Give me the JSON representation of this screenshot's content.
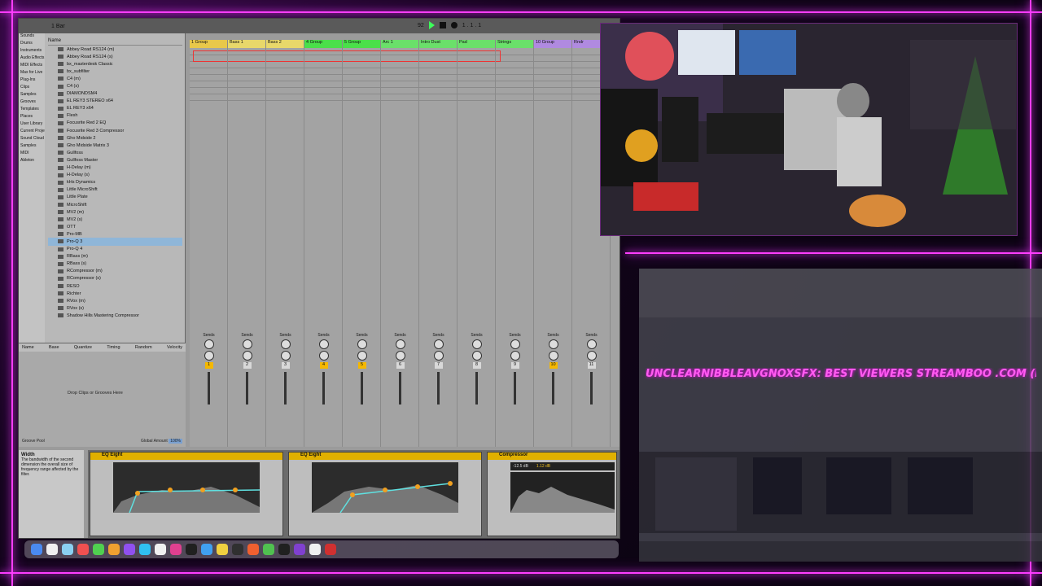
{
  "overlay": {
    "ticker_text": "UNCLEARNIBBLEAVGNOXSFX:  BEST VIEWERS STREAMBOO .COM (REMOVE THE SPA"
  },
  "daw": {
    "topbar": {
      "bpm": "92",
      "bars": "1 Bar",
      "counter": "1 . 1 . 1"
    },
    "browser": {
      "header": "Name",
      "categories": [
        "Sounds",
        "Drums",
        "Instruments",
        "Audio Effects",
        "MIDI Effects",
        "Max for Live",
        "Plug-Ins",
        "Clips",
        "Samples",
        "Grooves",
        "Templates",
        "Places",
        "User Library",
        "Current Project",
        "Sound Cloud",
        "Samples",
        "MIDI",
        "Ableton"
      ],
      "plugins": [
        "Abbey Road RS124 (m)",
        "Abbey Road RS124 (s)",
        "bx_masterdesk Classic",
        "bx_subfilter",
        "C4 (m)",
        "C4 (s)",
        "DIAMONDSM4",
        "EL REY3 STEREO x64",
        "EL REY3 x64",
        "Flesh",
        "Focusrite Red 2 EQ",
        "Focusrite Red 3 Compressor",
        "Gho Midside 2",
        "Gho Midside Matrix 3",
        "Gullfoss",
        "Gullfoss Master",
        "H-Delay (m)",
        "H-Delay (s)",
        "kHs Dynamics",
        "Little MicroShift",
        "Little Plate",
        "MicroShift",
        "MV2 (m)",
        "MV2 (s)",
        "OTT",
        "Pro-MB",
        "Pro-Q 3",
        "Pro-Q 4",
        "RBass (m)",
        "RBass (s)",
        "RCompressor (m)",
        "RCompressor (s)",
        "RESO",
        "Richter",
        "RVox (m)",
        "RVox (s)",
        "Shadow Hills Mastering Compressor"
      ],
      "selected_index": 26
    },
    "groove_pool": {
      "columns": [
        "Name",
        "Base",
        "Quantize",
        "Timing",
        "Random",
        "Velocity"
      ],
      "drop_text": "Drop Clips or Grooves Here",
      "global_amount_label": "Global Amount",
      "global_amount_value": "100%",
      "footer_left": "Groove Pool"
    },
    "info_view": {
      "title": "Width",
      "text": "The bandwidth of the second dimension the overall size of frequency range affected by the filter."
    },
    "tracks": [
      {
        "name": "1 Group",
        "color": "#e8c84a",
        "num": "1",
        "on": true
      },
      {
        "name": "Bass 1",
        "color": "#e8d86a",
        "num": "2",
        "on": false
      },
      {
        "name": "Bass 2",
        "color": "#e8d86a",
        "num": "3",
        "on": false
      },
      {
        "name": "4 Group",
        "color": "#4ae04a",
        "num": "4",
        "on": true
      },
      {
        "name": "5 Group",
        "color": "#4ae04a",
        "num": "5",
        "on": true
      },
      {
        "name": "Arc 1",
        "color": "#6ae06a",
        "num": "6",
        "on": false
      },
      {
        "name": "Intro Dust",
        "color": "#6ae06a",
        "num": "7",
        "on": false
      },
      {
        "name": "Pad",
        "color": "#6ae06a",
        "num": "8",
        "on": false
      },
      {
        "name": "Strings",
        "color": "#6ae06a",
        "num": "9",
        "on": false
      },
      {
        "name": "10 Group",
        "color": "#b08ae0",
        "num": "10",
        "on": true
      },
      {
        "name": "Rndr",
        "color": "#b08ae0",
        "num": "11",
        "on": false
      }
    ],
    "mixer_labels": {
      "audio_from": "Audio From",
      "monitor": "Monitor",
      "audio_to": "Audio To",
      "sends": "Sends"
    },
    "devices": [
      {
        "name": "EQ Eight",
        "type": "eq"
      },
      {
        "name": "EQ Eight",
        "type": "eq"
      },
      {
        "name": "Compressor",
        "type": "comp",
        "thresh": "-12.5 dB",
        "out": "1.12 dB"
      }
    ]
  },
  "dock_icon_colors": [
    "#4a8af0",
    "#f0f0f0",
    "#8ad0f0",
    "#f05050",
    "#50d050",
    "#f0a030",
    "#9050f0",
    "#30c0f0",
    "#f0f0f0",
    "#e04090",
    "#202020",
    "#40a0f0",
    "#f0d040",
    "#303030",
    "#f06030",
    "#50c050",
    "#202020",
    "#8040d0",
    "#f0f0f0",
    "#d03030"
  ]
}
